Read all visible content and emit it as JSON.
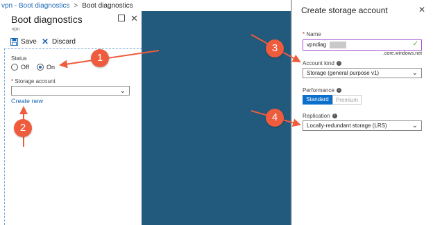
{
  "breadcrumb": {
    "items": [
      "vpn - Boot diagnostics",
      "Boot diagnostics"
    ],
    "separator": ">"
  },
  "left_blade": {
    "title": "Boot diagnostics",
    "subtitle": "vpn",
    "save_label": "Save",
    "discard_label": "Discard",
    "status_label": "Status",
    "status_options": [
      "Off",
      "On"
    ],
    "status_selected": "On",
    "storage_label": "Storage account",
    "storage_value": "",
    "create_new_label": "Create new"
  },
  "right_blade": {
    "title": "Create storage account",
    "name_label": "Name",
    "name_value": "vpndiag",
    "name_suffix": ".core.windows.net",
    "account_kind_label": "Account kind",
    "account_kind_value": "Storage (general purpose v1)",
    "performance_label": "Performance",
    "performance_options": [
      "Standard",
      "Premium"
    ],
    "performance_selected": "Standard",
    "replication_label": "Replication",
    "replication_value": "Locally-redundant storage (LRS)"
  },
  "annotations": [
    "1",
    "2",
    "3",
    "4"
  ],
  "colors": {
    "accent": "#0b6fcc",
    "dark_panel": "#215a7d",
    "annotation": "#ee5b3d",
    "required": "#c4262e",
    "valid": "#5aa526"
  }
}
